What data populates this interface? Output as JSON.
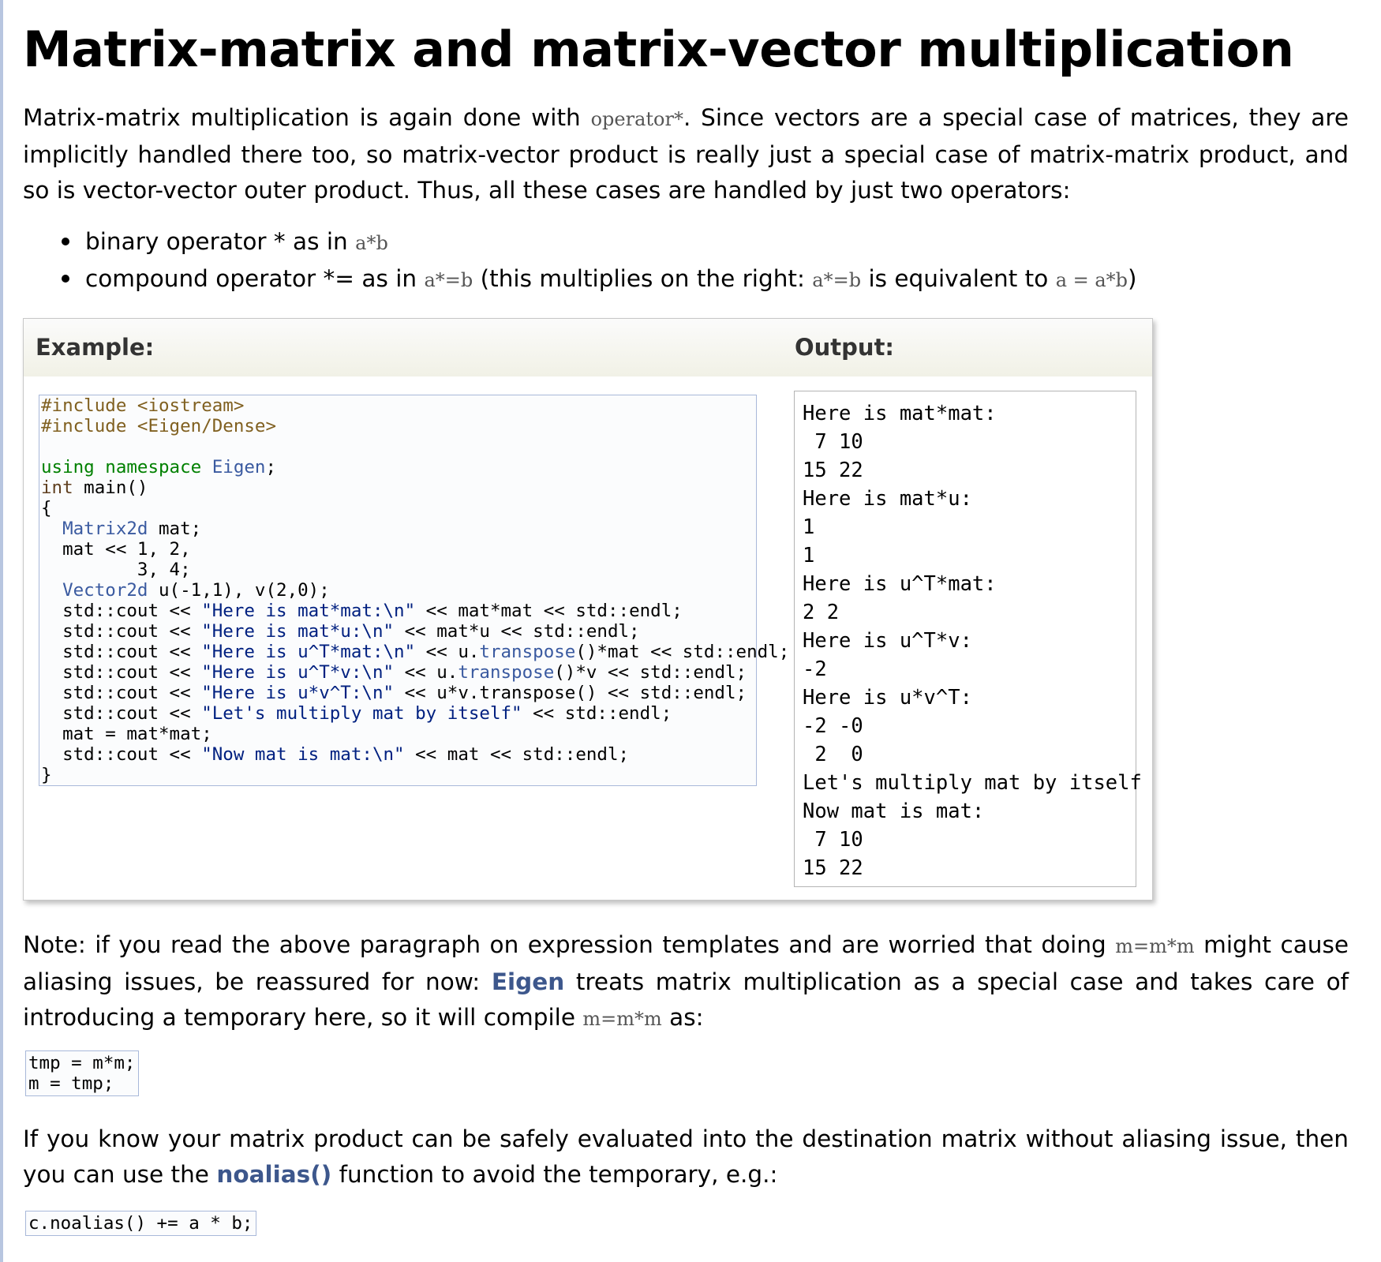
{
  "heading": "Matrix-matrix and matrix-vector multiplication",
  "intro": {
    "t1": "Matrix-matrix multiplication is again done with ",
    "c1": "operator*",
    "t2": ". Since vectors are a special case of matrices, they are implicitly handled there too, so matrix-vector product is really just a special case of matrix-matrix product, and so is vector-vector outer product. Thus, all these cases are handled by just two operators:"
  },
  "bullets": {
    "b1_text": "binary operator * as in ",
    "b1_code": "a*b",
    "b2_t1": "compound operator *= as in ",
    "b2_c1": "a*=b",
    "b2_t2": " (this multiplies on the right: ",
    "b2_c2": "a*=b",
    "b2_t3": " is equivalent to ",
    "b2_c3": "a = a*b",
    "b2_t4": ")"
  },
  "example": {
    "example_label": "Example:",
    "output_label": "Output:",
    "output_text": "Here is mat*mat:\n 7 10\n15 22\nHere is mat*u:\n1\n1\nHere is u^T*mat:\n2 2\nHere is u^T*v:\n-2\nHere is u*v^T:\n-2 -0\n 2  0\nLet's multiply mat by itself\nNow mat is mat:\n 7 10\n15 22"
  },
  "note": {
    "t1": "Note: if you read the above paragraph on expression templates and are worried that doing ",
    "c1": "m=m*m",
    "t2": " might cause aliasing issues, be reassured for now: ",
    "link": "Eigen",
    "t3": " treats matrix multiplication as a special case and takes care of introducing a temporary here, so it will compile ",
    "c2": "m=m*m",
    "t4": " as:"
  },
  "snippet1": "tmp = m*m;\nm = tmp;",
  "para3": {
    "t1": "If you know your matrix product can be safely evaluated into the destination matrix without aliasing issue, then you can use the ",
    "link": "noalias()",
    "t2": " function to avoid the temporary, e.g.:"
  },
  "snippet2": "c.noalias() += a * b;"
}
